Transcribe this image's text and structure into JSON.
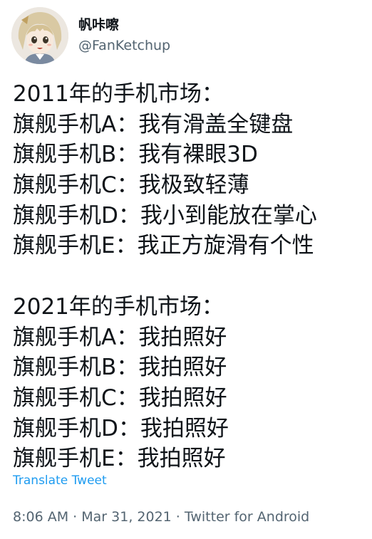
{
  "author": {
    "display_name": "帆咔嚓",
    "handle": "@FanKetchup"
  },
  "tweet": {
    "section_2011": {
      "heading": "2011年的手机市场：",
      "lines": [
        "旗舰手机A：我有滑盖全键盘",
        "旗舰手机B：我有裸眼3D",
        "旗舰手机C：我极致轻薄",
        "旗舰手机D：我小到能放在掌心",
        "旗舰手机E：我正方旋滑有个性"
      ]
    },
    "section_2021": {
      "heading": "2021年的手机市场：",
      "lines": [
        "旗舰手机A：我拍照好",
        "旗舰手机B：我拍照好",
        "旗舰手机C：我拍照好",
        "旗舰手机D：我拍照好",
        "旗舰手机E：我拍照好"
      ]
    }
  },
  "translate_label": "Translate Tweet",
  "meta": {
    "time": "8:06 AM",
    "separator": "·",
    "date": "Mar 31, 2021",
    "source": "Twitter for Android"
  },
  "colors": {
    "text": "#0f1419",
    "secondary": "#536471",
    "link": "#1d9bf0"
  }
}
